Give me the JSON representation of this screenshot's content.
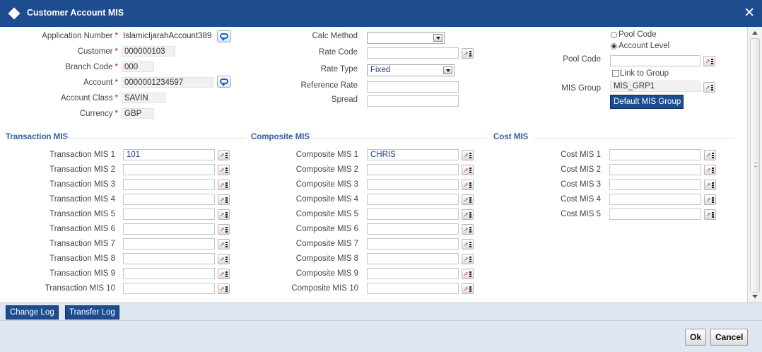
{
  "window": {
    "title": "Customer Account MIS",
    "close_glyph": "✕"
  },
  "left": {
    "application_number": {
      "label": "Application Number",
      "value": "IslamicIjarahAccount389"
    },
    "customer": {
      "label": "Customer",
      "value": "000000103"
    },
    "branch_code": {
      "label": "Branch Code",
      "value": "000"
    },
    "account": {
      "label": "Account",
      "value": "0000001234597"
    },
    "account_class": {
      "label": "Account Class",
      "value": "SAVIN"
    },
    "currency": {
      "label": "Currency",
      "value": "GBP"
    },
    "required_marker": "*"
  },
  "middle": {
    "calc_method": {
      "label": "Calc Method",
      "value": ""
    },
    "rate_code": {
      "label": "Rate Code",
      "value": ""
    },
    "rate_type": {
      "label": "Rate Type",
      "value": "Fixed"
    },
    "reference_rate": {
      "label": "Reference Rate",
      "value": ""
    },
    "spread": {
      "label": "Spread",
      "value": ""
    }
  },
  "right": {
    "pool_code_radio": "Pool Code",
    "account_level_radio": "Account Level",
    "selected_radio": "Account Level",
    "pool_code": {
      "label": "Pool Code",
      "value": ""
    },
    "link_to_group": {
      "label": "Link to Group",
      "checked": false
    },
    "mis_group": {
      "label": "MIS Group",
      "value": "MIS_GRP1"
    },
    "default_mis_group_button": "Default MIS Group"
  },
  "sections": {
    "transaction": {
      "title": "Transaction MIS",
      "rows": [
        {
          "label": "Transaction MIS 1",
          "value": "101"
        },
        {
          "label": "Transaction MIS 2",
          "value": ""
        },
        {
          "label": "Transaction MIS 3",
          "value": ""
        },
        {
          "label": "Transaction MIS 4",
          "value": ""
        },
        {
          "label": "Transaction MIS 5",
          "value": ""
        },
        {
          "label": "Transaction MIS 6",
          "value": ""
        },
        {
          "label": "Transaction MIS 7",
          "value": ""
        },
        {
          "label": "Transaction MIS 8",
          "value": ""
        },
        {
          "label": "Transaction MIS 9",
          "value": ""
        },
        {
          "label": "Transaction MIS 10",
          "value": ""
        }
      ]
    },
    "composite": {
      "title": "Composite MIS",
      "rows": [
        {
          "label": "Composite MIS 1",
          "value": "CHRIS"
        },
        {
          "label": "Composite MIS 2",
          "value": ""
        },
        {
          "label": "Composite MIS 3",
          "value": ""
        },
        {
          "label": "Composite MIS 4",
          "value": ""
        },
        {
          "label": "Composite MIS 5",
          "value": ""
        },
        {
          "label": "Composite MIS 6",
          "value": ""
        },
        {
          "label": "Composite MIS 7",
          "value": ""
        },
        {
          "label": "Composite MIS 8",
          "value": ""
        },
        {
          "label": "Composite MIS 9",
          "value": ""
        },
        {
          "label": "Composite MIS 10",
          "value": ""
        }
      ]
    },
    "cost": {
      "title": "Cost MIS",
      "rows": [
        {
          "label": "Cost MIS 1",
          "value": ""
        },
        {
          "label": "Cost MIS 2",
          "value": ""
        },
        {
          "label": "Cost MIS 3",
          "value": ""
        },
        {
          "label": "Cost MIS 4",
          "value": ""
        },
        {
          "label": "Cost MIS 5",
          "value": ""
        }
      ]
    }
  },
  "tabs": [
    "Change Log",
    "Transfer Log"
  ],
  "footer": {
    "ok": "Ok",
    "cancel": "Cancel"
  },
  "icons": {
    "lov": "lov-search-icon",
    "chat": "speech-bubble-icon",
    "close": "close-icon",
    "title": "diamond-icon"
  },
  "colors": {
    "titlebar": "#1d4c8f",
    "section_title": "#2f5fa3",
    "required": "#cc0000",
    "footer_bg": "#dfe7f2"
  }
}
